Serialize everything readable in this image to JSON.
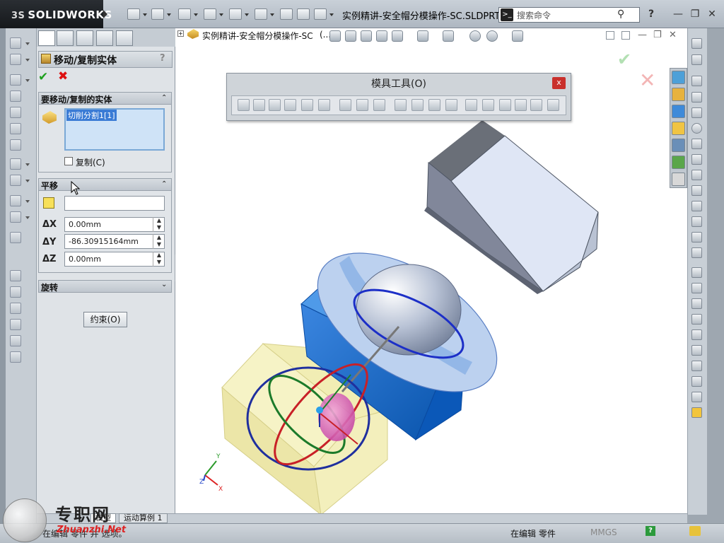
{
  "app": {
    "brand": "SOLIDWORKS",
    "brand_prefix": "3S"
  },
  "titlebar": {
    "doc_title": "实例精讲-安全帽分模操作-SC.SLDPRT *",
    "search_placeholder": "搜索命令",
    "help_label": "?"
  },
  "feature_tree": {
    "part_name": "实例精讲-安全帽分模操作-SC",
    "suffix": "(..."
  },
  "property_manager": {
    "title": "移动/复制实体",
    "help": "?",
    "bodies_group": {
      "title": "要移动/复制的实体",
      "items": [
        "切削分割1[1]"
      ],
      "copy_label": "复制(C)"
    },
    "translate_group": {
      "title": "平移",
      "reference_value": "",
      "dx_label": "ΔX",
      "dx_value": "0.00mm",
      "dy_label": "ΔY",
      "dy_value": "-86.30915164mm",
      "dz_label": "ΔZ",
      "dz_value": "0.00mm"
    },
    "rotate_group": {
      "title": "旋转"
    },
    "constraint_button": "约束(O)"
  },
  "mold_toolbar": {
    "title": "模具工具(O)",
    "close": "x"
  },
  "bottom_tabs": [
    "模型",
    "运动算例 1"
  ],
  "statusbar": {
    "left": "在编辑 零件 并 选项。",
    "editing": "在编辑 零件",
    "units": "MMGS",
    "help": "?"
  },
  "watermark": {
    "text": "专职网",
    "url": "Zhuanzhi.Net"
  },
  "triad": {
    "x": "X",
    "y": "Y",
    "z": "Z"
  },
  "colors": {
    "accent": "#1f6fd1",
    "ok": "#1ea01e",
    "cancel": "#d11111",
    "blue_body": "#0d62c4",
    "yellow_body": "#f4f1bd"
  }
}
